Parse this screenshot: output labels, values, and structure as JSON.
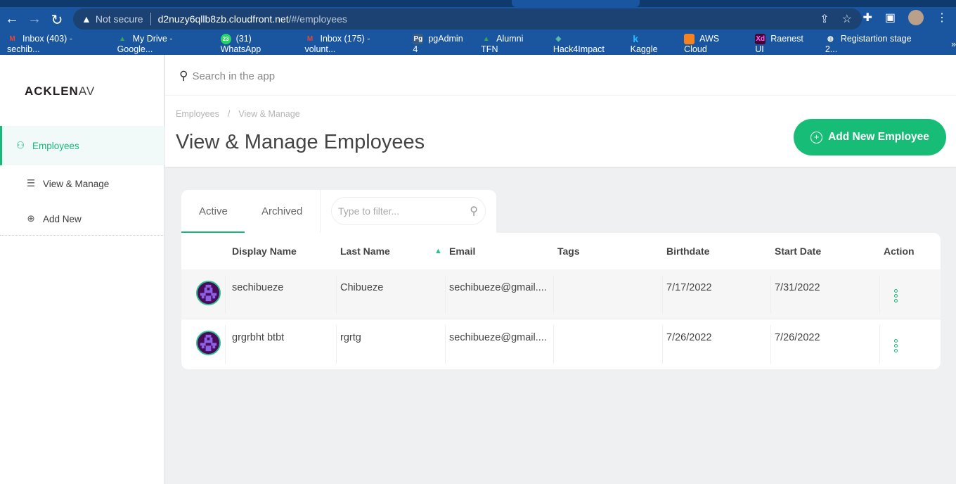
{
  "browser": {
    "security": "Not secure",
    "url_host": "d2nuzy6qllb8zb.cloudfront.net",
    "url_path": "/#/employees",
    "bookmarks": [
      {
        "label": "Inbox (403) - sechib...",
        "icon": "gmail-icon",
        "color": "#ea4335"
      },
      {
        "label": "My Drive - Google...",
        "icon": "google-drive-icon",
        "color": "#34a853"
      },
      {
        "label": "(31) WhatsApp",
        "icon": "whatsapp-icon",
        "color": "#25d366"
      },
      {
        "label": "Inbox (175) - volunt...",
        "icon": "gmail-icon",
        "color": "#ea4335"
      },
      {
        "label": "pgAdmin 4",
        "icon": "pgadmin-icon",
        "color": "#3a5c80"
      },
      {
        "label": "Alumni TFN",
        "icon": "google-drive-icon",
        "color": "#34a853"
      },
      {
        "label": "Hack4Impact",
        "icon": "hack4impact-icon",
        "color": "#5fc3a8"
      },
      {
        "label": "Kaggle",
        "icon": "kaggle-icon",
        "color": "#20beff"
      },
      {
        "label": "AWS Cloud",
        "icon": "aws-icon",
        "color": "#f58220"
      },
      {
        "label": "Raenest UI",
        "icon": "adobe-xd-icon",
        "color": "#470137"
      },
      {
        "label": "Registartion stage 2...",
        "icon": "globe-icon",
        "color": "#ffffff"
      }
    ],
    "whatsapp_badge": "23",
    "pg_badge": "Pg",
    "xd_badge": "Xd",
    "kaggle_badge": "k",
    "more": "»"
  },
  "sidebar": {
    "logo": "ACKLEN",
    "logo_tail": "AV",
    "items": [
      {
        "label": "Employees",
        "icon": "user-icon",
        "active": true
      },
      {
        "label": "View & Manage",
        "icon": "list-icon"
      },
      {
        "label": "Add New",
        "icon": "plus-circle-icon"
      }
    ]
  },
  "header": {
    "search_placeholder": "Search in the app",
    "breadcrumb": [
      "Employees",
      "View & Manage"
    ],
    "breadcrumb_sep": "/",
    "title": "View & Manage Employees",
    "add_button": "Add New Employee"
  },
  "tabs": [
    {
      "label": "Active",
      "active": true
    },
    {
      "label": "Archived"
    }
  ],
  "filter_placeholder": "Type to filter...",
  "table": {
    "columns": [
      "Display Name",
      "Last Name",
      "Email",
      "Tags",
      "Birthdate",
      "Start Date",
      "Action"
    ],
    "sort": {
      "column": "Email",
      "direction": "asc",
      "glyph": "▲"
    },
    "rows": [
      {
        "display_name": "sechibueze",
        "last_name": "Chibueze",
        "email": "sechibueze@gmail....",
        "tags": "",
        "birthdate": "7/17/2022",
        "start_date": "7/31/2022"
      },
      {
        "display_name": "grgrbht btbt",
        "last_name": "rgrtg",
        "email": "sechibueze@gmail....",
        "tags": "",
        "birthdate": "7/26/2022",
        "start_date": "7/26/2022"
      }
    ]
  },
  "colors": {
    "accent": "#17b978",
    "button": "#17bd76",
    "chrome": "#1a56a0"
  }
}
